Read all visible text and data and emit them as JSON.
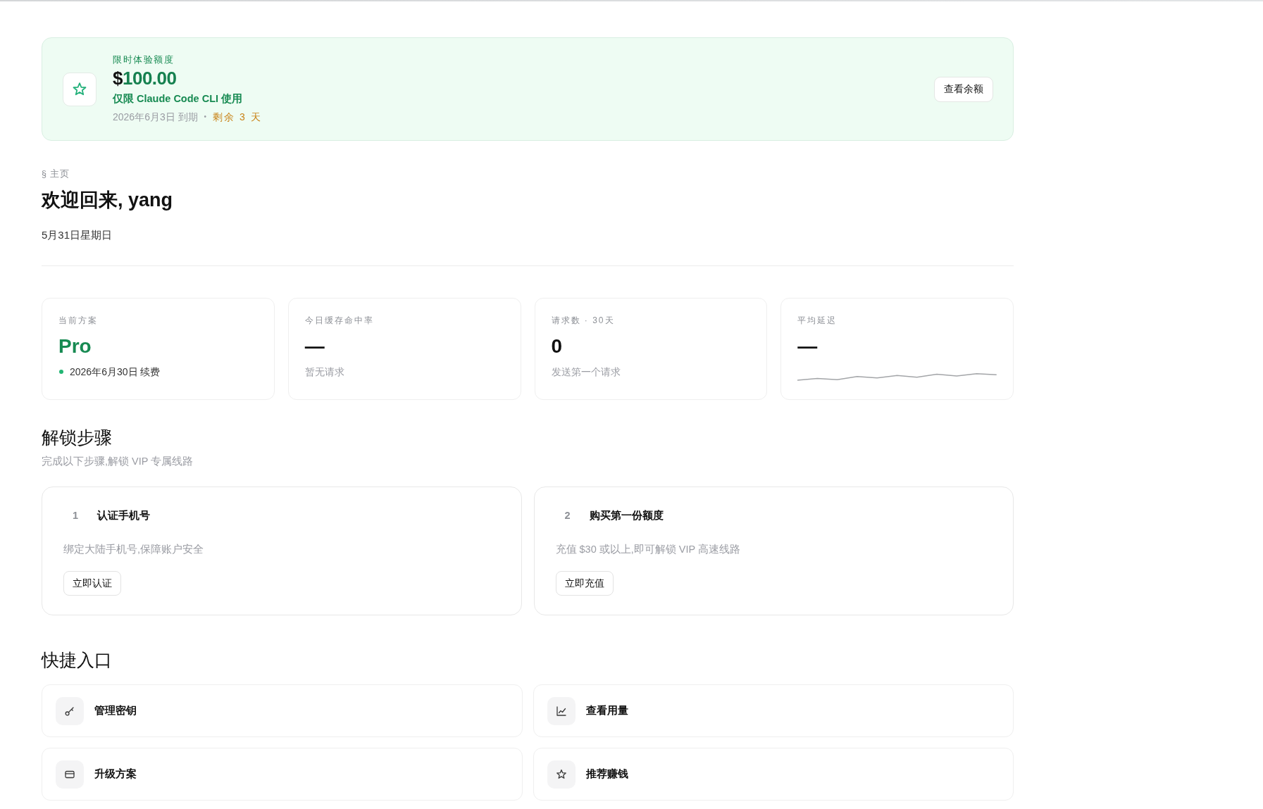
{
  "trial_banner": {
    "label": "限时体验额度",
    "amount": "$100.00",
    "scope": "仅限 Claude Code CLI 使用",
    "expiry": "2026年6月3日 到期",
    "separator": "•",
    "remaining": "剩余 3 天",
    "button": "查看余额"
  },
  "page_header": {
    "breadcrumb": "§ 主页",
    "title": "欢迎回来, yang",
    "date": "5月31日星期日"
  },
  "stats": [
    {
      "kind": "plan",
      "label": "当前方案",
      "value": "Pro",
      "sub": "2026年6月30日 续费"
    },
    {
      "kind": "metric",
      "label": "今日缓存命中率",
      "value": "—",
      "sub": "暂无请求"
    },
    {
      "kind": "metric",
      "label": "请求数 · 30天",
      "value": "0",
      "sub": "发送第一个请求"
    },
    {
      "kind": "trend",
      "label": "平均延迟",
      "value": "—"
    }
  ],
  "unlock_steps": {
    "title": "解锁步骤",
    "subtitle": "完成以下步骤,解锁 VIP 专属线路",
    "steps": [
      {
        "number": "1",
        "title": "认证手机号",
        "description": "绑定大陆手机号,保障账户安全",
        "action": "立即认证"
      },
      {
        "number": "2",
        "title": "购买第一份额度",
        "description": "充值 $30 或以上,即可解锁 VIP 高速线路",
        "action": "立即充值"
      }
    ]
  },
  "quick_links": {
    "title": "快捷入口",
    "items": [
      {
        "label": "管理密钥"
      },
      {
        "label": "查看用量"
      },
      {
        "label": "升级方案"
      },
      {
        "label": "推荐赚钱"
      }
    ]
  }
}
